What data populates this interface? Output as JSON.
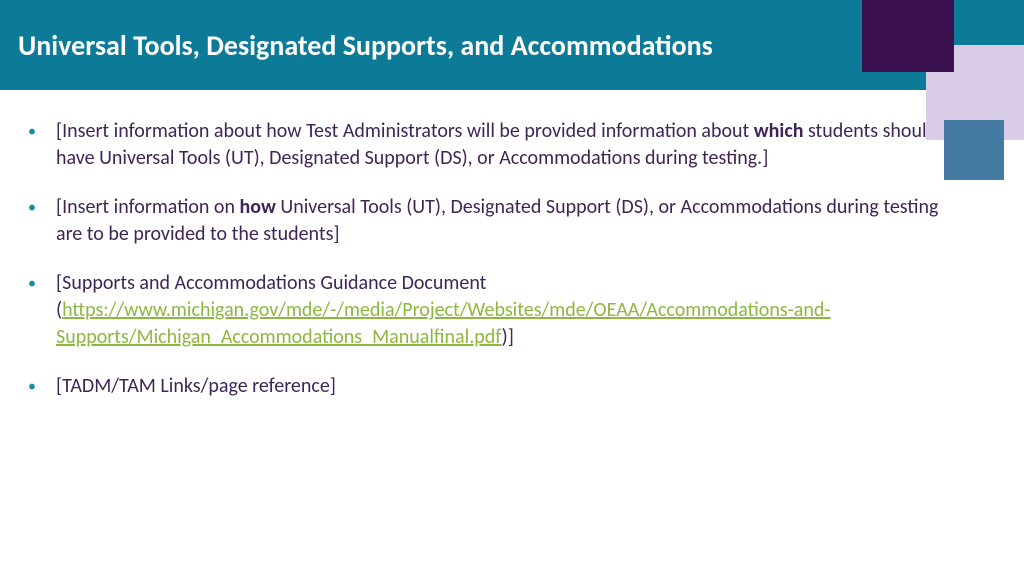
{
  "header": {
    "title": "Universal Tools, Designated Supports, and Accommodations"
  },
  "bullets": {
    "b1_pre": "[Insert information about how Test Administrators will be provided information about ",
    "b1_bold": "which",
    "b1_post": " students should have Universal Tools (UT), Designated Support (DS), or Accommodations during testing.]",
    "b2_pre": "[Insert information on ",
    "b2_bold": "how",
    "b2_post": " Universal Tools (UT), Designated Support (DS), or Accommodations during testing are to be provided to the students]",
    "b3_pre": "[Supports and Accommodations Guidance Document (",
    "b3_link": "https://www.michigan.gov/mde/-/media/Project/Websites/mde/OEAA/Accommodations-and-Supports/Michigan_Accommodations_Manualfinal.pdf",
    "b3_post": ")]",
    "b4": "[TADM/TAM Links/page reference]"
  },
  "colors": {
    "header_bg": "#0d7a98",
    "text": "#3f2557",
    "link": "#8cb83f",
    "sq_purple": "#3c1150",
    "sq_lav": "#d8cce6",
    "sq_blue": "#457ba3"
  }
}
